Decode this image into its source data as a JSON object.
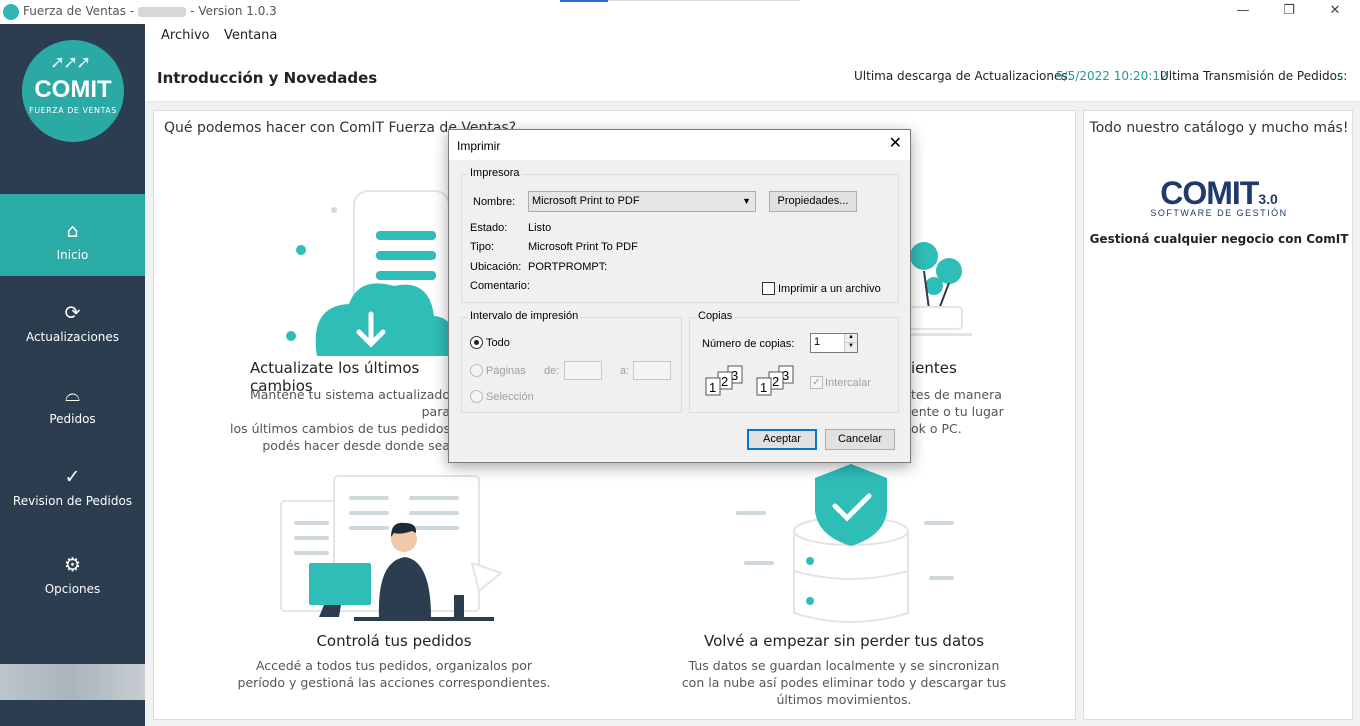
{
  "window": {
    "title_prefix": "Fuerza de Ventas -",
    "title_suffix": "- Version 1.0.3",
    "minimize": "—",
    "maximize": "❐",
    "close": "✕"
  },
  "logo": {
    "brand": "COMIT",
    "tagline": "FUERZA DE VENTAS"
  },
  "sidebar": {
    "items": [
      {
        "label": "Inicio",
        "icon": "home-icon",
        "glyph": "⌂",
        "active": true
      },
      {
        "label": "Actualizaciones",
        "icon": "refresh-icon",
        "glyph": "⟳",
        "active": false
      },
      {
        "label": "Pedidos",
        "icon": "basket-icon",
        "glyph": "⌓",
        "active": false
      },
      {
        "label": "Revision de Pedidos",
        "icon": "check-circle-icon",
        "glyph": "✓",
        "active": false
      },
      {
        "label": "Opciones",
        "icon": "gear-icon",
        "glyph": "⚙",
        "active": false
      }
    ]
  },
  "menubar": {
    "archivo": "Archivo",
    "ventana": "Ventana"
  },
  "header": {
    "title": "Introducción y Novedades",
    "last_download_label": "Ultima descarga de Actualizaciones:",
    "last_download_value": "5/5/2022 10:20:12",
    "last_transmission_label": "Ultima Transmisión de Pedidos:",
    "last_transmission_value": "-"
  },
  "main": {
    "question": "Qué podemos hacer con ComIT Fuerza de Ventas?",
    "features": [
      {
        "title": "Actualizate los últimos cambios",
        "desc": [
          "Mantené tu sistema actualizado para",
          "los últimos cambios de tus pedidos",
          "podés hacer desde donde sea"
        ]
      },
      {
        "title": "ientes",
        "desc": [
          "tes de manera",
          "ente o tu lugar",
          "ok o PC."
        ]
      },
      {
        "title": "Controlá tus pedidos",
        "desc": [
          "Accedé a todos tus pedidos, organizalos por",
          "período y gestioná las acciones correspondientes."
        ]
      },
      {
        "title": "Volvé a empezar sin perder tus datos",
        "desc": [
          "Tus datos se guardan localmente y se sincronizan",
          "con la nube así podes eliminar todo y descargar tus",
          "últimos movimientos."
        ]
      }
    ]
  },
  "sidepanel": {
    "title": "Todo nuestro catálogo y mucho más!",
    "brand": "COMIT",
    "version": "3.0",
    "tagline": "SOFTWARE DE GESTIÓN",
    "subtitle": "Gestioná cualquier negocio con ComIT"
  },
  "print_dialog": {
    "title": "Imprimir",
    "printer_group": "Impresora",
    "name_label": "Nombre:",
    "name_value": "Microsoft Print to PDF",
    "properties_button": "Propiedades...",
    "status_label": "Estado:",
    "status_value": "Listo",
    "type_label": "Tipo:",
    "type_value": "Microsoft Print To PDF",
    "location_label": "Ubicación:",
    "location_value": "PORTPROMPT:",
    "comment_label": "Comentario:",
    "print_to_file": "Imprimir a un archivo",
    "print_to_file_checked": false,
    "range_group": "Intervalo de impresión",
    "range_all": "Todo",
    "range_pages": "Páginas",
    "from_label": "de:",
    "to_label": "a:",
    "range_selection": "Selección",
    "copies_group": "Copias",
    "copies_label": "Número de copias:",
    "copies_value": "1",
    "collate": "Intercalar",
    "collate_checked": true,
    "ok_button": "Aceptar",
    "cancel_button": "Cancelar"
  },
  "colors": {
    "sidebar": "#2b3d4f",
    "accent": "#2aaba6",
    "brand_dark": "#1f3a6b"
  }
}
